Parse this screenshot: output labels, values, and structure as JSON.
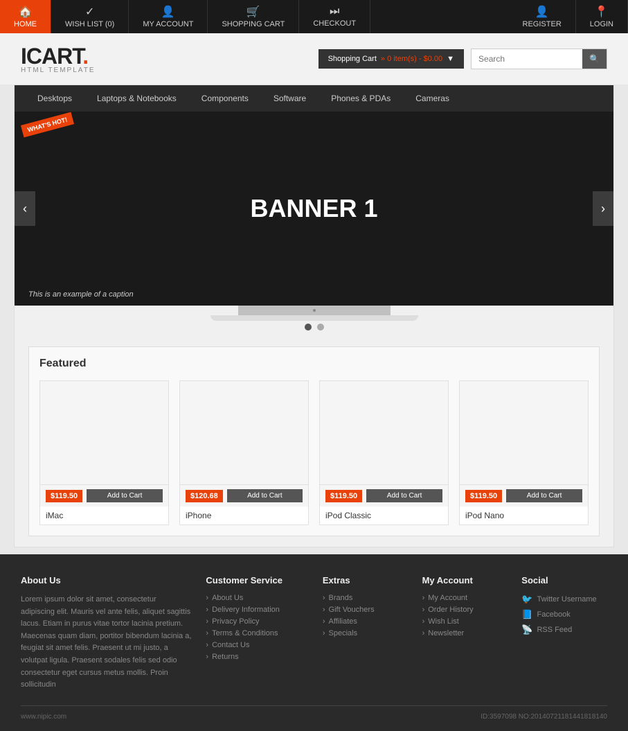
{
  "topnav": {
    "items": [
      {
        "id": "home",
        "label": "HOME",
        "icon": "🏠",
        "active": true
      },
      {
        "id": "wishlist",
        "label": "WISH LIST (0)",
        "icon": "✓"
      },
      {
        "id": "myaccount",
        "label": "MY ACCOUNT",
        "icon": "👤"
      },
      {
        "id": "shoppingcart",
        "label": "SHOPPING CART",
        "icon": "🛒"
      },
      {
        "id": "checkout",
        "label": "CHECKOUT",
        "icon": "⏭"
      }
    ],
    "right_items": [
      {
        "id": "register",
        "label": "REGISTER",
        "icon": "👤"
      },
      {
        "id": "login",
        "label": "LOGIN",
        "icon": "📍"
      }
    ]
  },
  "header": {
    "logo": "ICART",
    "logo_dot": ".",
    "logo_sub": "HTML TEMPLATE",
    "cart_label": "Shopping Cart",
    "cart_items": "» 0 item(s) - $0.00",
    "search_placeholder": "Search"
  },
  "category_nav": {
    "items": [
      "Desktops",
      "Laptops & Notebooks",
      "Components",
      "Software",
      "Phones & PDAs",
      "Cameras"
    ]
  },
  "slider": {
    "badge": "WHAT'S HOT!",
    "banner_text": "BANNER 1",
    "caption": "This is an example of a caption",
    "dots": [
      {
        "active": true
      },
      {
        "active": false
      }
    ]
  },
  "featured": {
    "title": "Featured",
    "products": [
      {
        "name": "iMac",
        "price": "$119.50",
        "add_label": "Add to Cart"
      },
      {
        "name": "iPhone",
        "price": "$120.68",
        "add_label": "Add to Cart"
      },
      {
        "name": "iPod Classic",
        "price": "$119.50",
        "add_label": "Add to Cart"
      },
      {
        "name": "iPod Nano",
        "price": "$119.50",
        "add_label": "Add to Cart"
      }
    ]
  },
  "footer": {
    "about": {
      "title": "About Us",
      "text": "Lorem ipsum dolor sit amet, consectetur adipiscing elit. Mauris vel ante felis, aliquet sagittis lacus. Etiam in purus vitae tortor lacinia pretium. Maecenas quam diam, portitor bibendum lacinia a, feugiat sit amet felis. Praesent ut mi justo, a volutpat ligula. Praesent sodales felis sed odio consectetur eget cursus metus mollis. Proin sollicitudin"
    },
    "customer_service": {
      "title": "Customer Service",
      "links": [
        "About Us",
        "Delivery Information",
        "Privacy Policy",
        "Terms & Conditions",
        "Contact Us",
        "Returns"
      ]
    },
    "extras": {
      "title": "Extras",
      "links": [
        "Brands",
        "Gift Vouchers",
        "Affiliates",
        "Specials"
      ]
    },
    "my_account": {
      "title": "My Account",
      "links": [
        "My Account",
        "Order History",
        "Wish List",
        "Newsletter"
      ]
    },
    "social": {
      "title": "Social",
      "links": [
        {
          "icon": "🐦",
          "label": "Twitter Username"
        },
        {
          "icon": "📘",
          "label": "Facebook"
        },
        {
          "icon": "📡",
          "label": "RSS Feed"
        }
      ]
    }
  },
  "watermark": {
    "site": "www.nipic.com",
    "id": "ID:3597098 NO:20140721181441818140"
  }
}
